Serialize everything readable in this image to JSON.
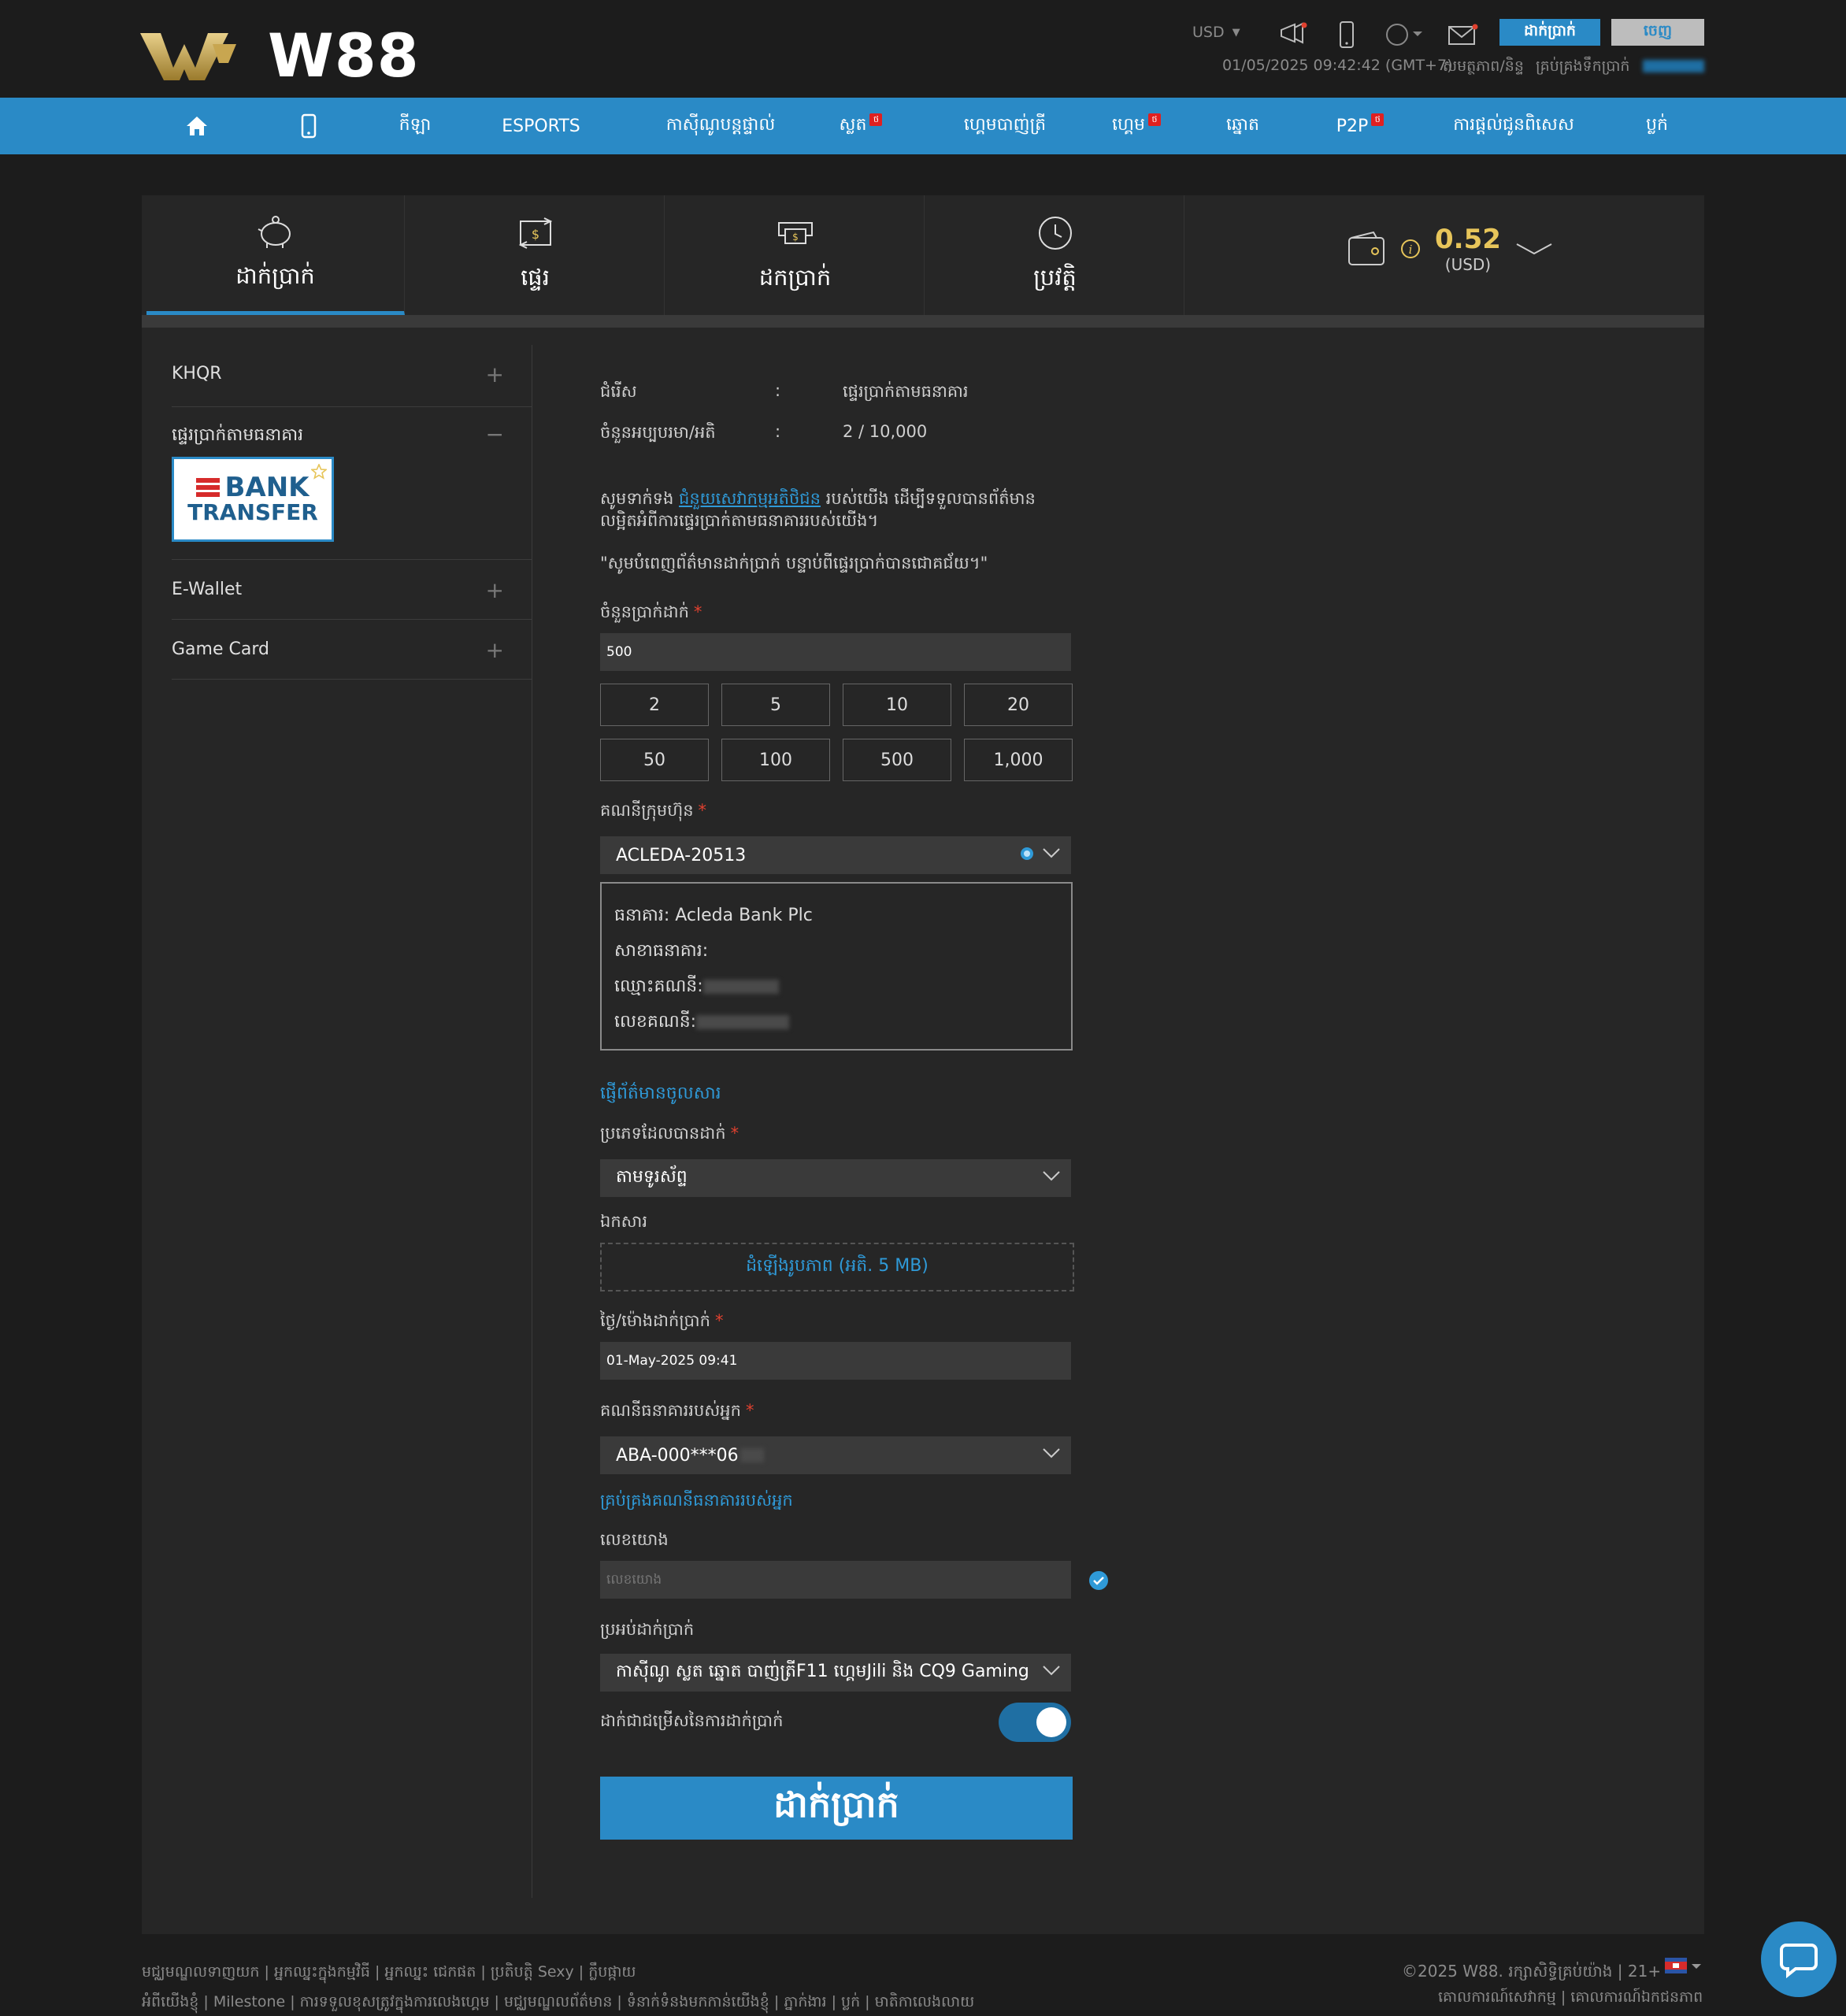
{
  "header": {
    "brand": "W88",
    "currency": "USD",
    "datetime": "01/05/2025 09:42:42 (GMT+7)",
    "link_member": "សមត្ថភាព/និន្ទ",
    "link_manage": "គ្រប់គ្រងទឹកប្រាក់",
    "deposit_btn": "ដាក់ប្រាក់",
    "logout_btn": "ចេញ",
    "icons": [
      "megaphone-icon",
      "mobile-icon",
      "language-icon",
      "mail-icon"
    ]
  },
  "nav": {
    "items": [
      {
        "label": "",
        "icon": "home-icon"
      },
      {
        "label": "",
        "icon": "mobile-icon"
      },
      {
        "label": "កីឡា"
      },
      {
        "label": "ESPORTS"
      },
      {
        "label": "កាស៊ីណូបន្តផ្ទាល់"
      },
      {
        "label": "ស្លត",
        "badge": "ថ"
      },
      {
        "label": "ហ្គេមបាញ់ត្រី"
      },
      {
        "label": "ហ្គេម",
        "badge": "ថ"
      },
      {
        "label": "ឆ្នោត"
      },
      {
        "label": "P2P",
        "badge": "ថ"
      },
      {
        "label": "ការផ្ដល់ជូនពិសេស"
      },
      {
        "label": "ប្លក់"
      }
    ]
  },
  "tabs": [
    {
      "label": "ដាក់ប្រាក់",
      "icon": "piggy-bank-icon",
      "active": true
    },
    {
      "label": "ផ្ទេរ",
      "icon": "transfer-icon"
    },
    {
      "label": "ដកប្រាក់",
      "icon": "withdraw-icon"
    },
    {
      "label": "ប្រវត្តិ",
      "icon": "history-icon"
    }
  ],
  "wallet": {
    "balance": "0.52",
    "currency": "(USD)"
  },
  "sidebar": {
    "items": [
      {
        "label": "KHQR",
        "toggle": "+"
      },
      {
        "label": "ផ្ទេរប្រាក់តាមធនាគារ",
        "toggle": "−"
      },
      {
        "label": "E-Wallet",
        "toggle": "+"
      },
      {
        "label": "Game Card",
        "toggle": "+"
      }
    ],
    "bank_logo_top": "BANK",
    "bank_logo_bottom": "TRANSFER"
  },
  "form": {
    "method_label": "ជំរើស",
    "method_value": "ផ្ទេរប្រាក់តាមធនាគារ",
    "minmax_label": "ចំនួនអប្បបរមា/អតិ",
    "minmax_value": "2 / 10,000",
    "colon": ":",
    "note_pre": "សូមទាក់ទង",
    "note_link": "ជំនួយសេវាកម្មអតិថិជន",
    "note_post": "របស់យើង ដើម្បីទទួលបានព័ត៌មាន",
    "note_line2": "លម្អិតអំពីការផ្ទេរប្រាក់តាមធនាគាររបស់យើង។",
    "note_quote": "\"សូមបំពេញព័ត៌មានដាក់ប្រាក់ បន្ទាប់ពីផ្ទេរប្រាក់បានជោគជ័យ។\"",
    "amount_label": "ចំនួនប្រាក់ដាក់",
    "amount_value": "500",
    "amounts": [
      "2",
      "5",
      "10",
      "20",
      "50",
      "100",
      "500",
      "1,000"
    ],
    "company_acc_label": "គណនីក្រុមហ៊ុន",
    "company_acc_value": "ACLEDA-20513",
    "bank_line": "ធនាគារ: Acleda Bank Plc",
    "branch_line": "សាខាធនាគារ:",
    "accname_line": "ឈ្មោះគណនី:",
    "accno_line": "លេខគណនី:",
    "copy_link": "ផ្ញើព័ត៌មានចូលសារ",
    "deposit_type_label": "ប្រភេទដែលបានដាក់",
    "deposit_type_value": "តាមទូរស័ព្ទ",
    "doc_label": "ឯកសារ",
    "upload_text": "ដំឡើងរូបភាព (អតិ. 5 MB)",
    "datetime_label": "ថ្ងៃ/ម៉ោងដាក់ប្រាក់",
    "datetime_value": "01-May-2025 09:41",
    "your_acc_label": "គណនីធនាគាររបស់អ្នក",
    "your_acc_value": "ABA-000***06",
    "manage_acc_link": "គ្រប់គ្រងគណនីធនាគាររបស់អ្នក",
    "ref_label": "លេខយោង",
    "ref_placeholder": "លេខយោង",
    "bonus_label": "ប្រអប់ដាក់ប្រាក់",
    "bonus_value": "កាស៊ីណូ ស្លត ឆ្នោត បាញ់ត្រីF11 ហ្គេមJili និង CQ9 Gaming",
    "toggle_label": "ដាក់ជាជម្រើសនៃការដាក់ប្រាក់",
    "toggle_on": true,
    "submit": "ដាក់ប្រាក់"
  },
  "footer": {
    "row1": "មជ្ឈមណ្ឌលទាញយក | អ្នកឈ្នះក្នុងកម្មវិធី | អ្នកឈ្នះ ជេកផត | ប្រតិបត្តិ Sexy | ក្លឹបផ្កាយ",
    "row2": "អំពីយើងខ្ញុំ | Milestone | ការទទួលខុសត្រូវក្នុងការលេងហ្គេម | មជ្ឈមណ្ឌលព័ត៌មាន | ទំនាក់ទំនងមកកាន់យើងខ្ញុំ | ភ្នាក់ងារ | ប្លក់ | មាតិកាលេងលាយ",
    "copyright": "©2025 W88. រក្សាសិទ្ធិគ្រប់យ៉ាង | 21+",
    "policy": "គោលការណ៍សេវាកម្ម | គោលការណ៍ឯកជនភាព"
  },
  "colors": {
    "accent": "#2a8ac6",
    "balance": "#e7c55a",
    "required": "#e0412f"
  }
}
